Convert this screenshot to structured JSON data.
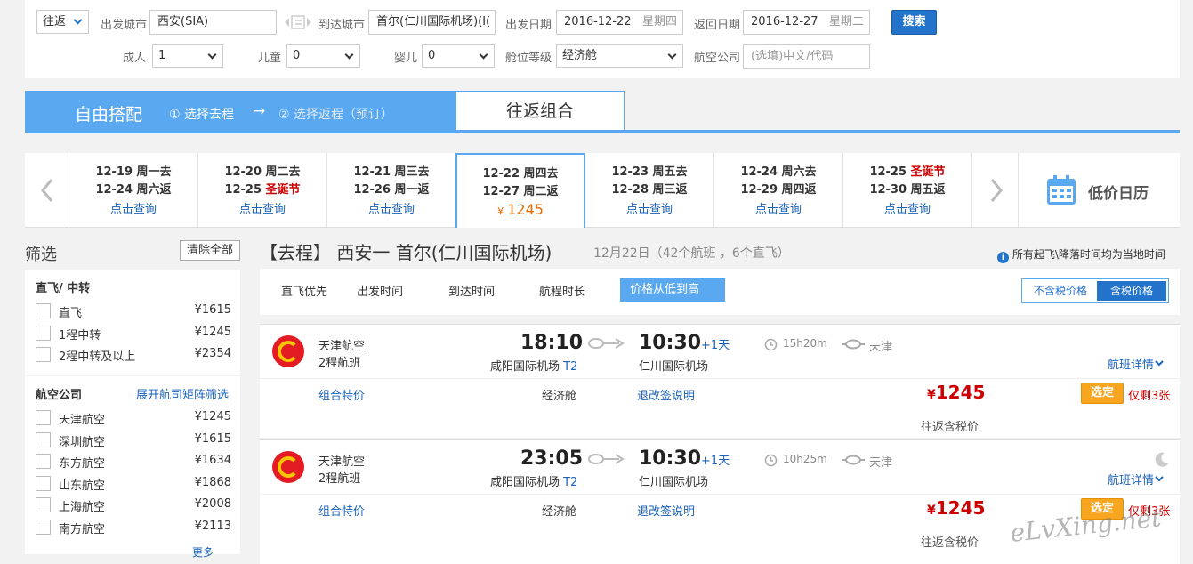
{
  "search": {
    "trip_type": "往返",
    "from_label": "出发城市",
    "from_value": "西安(SIA)",
    "to_label": "到达城市",
    "to_value": "首尔(仁川国际机场)(I(",
    "depart_label": "出发日期",
    "depart_date": "2016-12-22",
    "depart_weekday": "星期四",
    "return_label": "返回日期",
    "return_date": "2016-12-27",
    "return_weekday": "星期二",
    "search_button": "搜索",
    "adult_label": "成人",
    "adult_value": "1",
    "child_label": "儿童",
    "child_value": "0",
    "infant_label": "婴儿",
    "infant_value": "0",
    "cabin_label": "舱位等级",
    "cabin_value": "经济舱",
    "airline_label": "航空公司",
    "airline_placeholder": "(选填)中文/代码"
  },
  "mode": {
    "free_title": "自由搭配",
    "step1": "① 选择去程",
    "arrow": "→",
    "step2": "② 选择返程（预订）",
    "combo_tab": "往返组合"
  },
  "dates": [
    {
      "l1": "12-19 周一去",
      "l2": "12-24 周六返",
      "l2_red": "",
      "l3": "点击查询"
    },
    {
      "l1": "12-20 周二去",
      "l2": "12-25 ",
      "l2_red": "圣诞节",
      "l3": "点击查询"
    },
    {
      "l1": "12-21 周三去",
      "l2": "12-26 周一返",
      "l2_red": "",
      "l3": "点击查询"
    },
    {
      "l1": "12-22 周四去",
      "l2": "12-27 周二返",
      "l2_red": "",
      "l3_currency": "¥",
      "l3_price": "1245"
    },
    {
      "l1": "12-23 周五去",
      "l2": "12-28 周三返",
      "l2_red": "",
      "l3": "点击查询"
    },
    {
      "l1": "12-24 周六去",
      "l2": "12-29 周四返",
      "l2_red": "",
      "l3": "点击查询"
    },
    {
      "l1_pre": "12-25 ",
      "l1_red": "圣诞节",
      "l2": "12-30 周五返",
      "l2_red": "",
      "l3": "点击查询"
    }
  ],
  "calendar_label": "低价日历",
  "filter": {
    "title": "筛选",
    "clear_all": "清除全部",
    "direct_title": "直飞/ 中转",
    "direct_items": [
      {
        "name": "直飞",
        "price": "¥1615"
      },
      {
        "name": "1程中转",
        "price": "¥1245"
      },
      {
        "name": "2程中转及以上",
        "price": "¥2354"
      }
    ],
    "airline_title": "航空公司",
    "airline_expand": "展开航司矩阵筛选",
    "airline_items": [
      {
        "name": "天津航空",
        "price": "¥1245"
      },
      {
        "name": "深圳航空",
        "price": "¥1615"
      },
      {
        "name": "东方航空",
        "price": "¥1634"
      },
      {
        "name": "山东航空",
        "price": "¥1868"
      },
      {
        "name": "上海航空",
        "price": "¥2008"
      },
      {
        "name": "南方航空",
        "price": "¥2113"
      }
    ],
    "more": "更多"
  },
  "header": {
    "prefix": "【去程】",
    "route": "西安一 首尔(仁川国际机场)",
    "summary": "12月22日（42个航班 ，6个直飞）",
    "note": "所有起飞\\降落时间均为当地时间"
  },
  "sort": {
    "direct_first": "直飞优先",
    "depart_time": "出发时间",
    "arrive_time": "到达时间",
    "duration": "航程时长",
    "price_low": "价格从低到高",
    "price_excl_tax": "不含税价格",
    "price_incl_tax": "含税价格"
  },
  "flights": [
    {
      "airline": "天津航空",
      "legs": "2程航班",
      "dep_time": "18:10",
      "dep_airport": "咸阳国际机场",
      "dep_terminal": "T2",
      "arr_time": "10:30",
      "arr_plus": "+1天",
      "arr_airport": "仁川国际机场",
      "duration": "15h20m",
      "transfer": "天津",
      "details": "航班详情",
      "combo": "组合特价",
      "cabin": "经济舱",
      "rules": "退改签说明",
      "currency": "¥",
      "price": "1245",
      "select": "选定",
      "remain": "仅剩3张",
      "tax_note": "往返含税价"
    },
    {
      "airline": "天津航空",
      "legs": "2程航班",
      "dep_time": "23:05",
      "dep_airport": "咸阳国际机场",
      "dep_terminal": "T2",
      "arr_time": "10:30",
      "arr_plus": "+1天",
      "arr_airport": "仁川国际机场",
      "duration": "10h25m",
      "transfer": "天津",
      "details": "航班详情",
      "combo": "组合特价",
      "cabin": "经济舱",
      "rules": "退改签说明",
      "currency": "¥",
      "price": "1245",
      "select": "选定",
      "remain": "仅剩3张",
      "tax_note": "往返含税价"
    }
  ],
  "watermark": "eLvXing.net",
  "colors": {
    "accent": "#5aa8ef",
    "price": "#cc0000",
    "link": "#1a62b8",
    "select": "#f8a520"
  }
}
